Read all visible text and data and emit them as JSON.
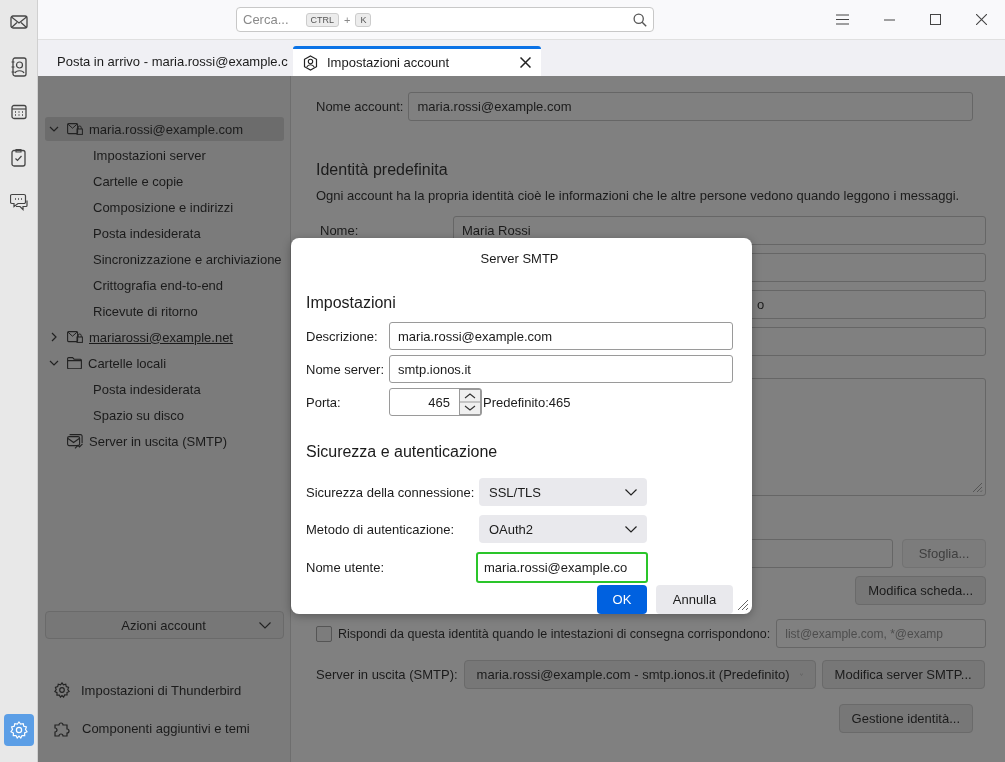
{
  "spaces_bar": {
    "items": [
      {
        "kind": "mail",
        "selected": false
      },
      {
        "kind": "contacts",
        "selected": false
      },
      {
        "kind": "calendar",
        "selected": false
      },
      {
        "kind": "tasks",
        "selected": false
      },
      {
        "kind": "chat",
        "selected": false
      }
    ],
    "bottom": {
      "kind": "settings",
      "selected": true
    }
  },
  "search": {
    "placeholder": "Cerca...",
    "keys": [
      "CTRL",
      "K"
    ],
    "joiner": "+"
  },
  "tabs": [
    {
      "label": "Posta in arrivo - maria.rossi@example.c",
      "kind": "inbox",
      "selected": false,
      "closable": false
    },
    {
      "label": "Impostazioni account",
      "kind": "account",
      "selected": true,
      "closable": true
    }
  ],
  "sidebar": {
    "tree": [
      {
        "label": "maria.rossi@example.com",
        "kind": "account",
        "expanded": true,
        "selected": true,
        "hovered": false,
        "children": [
          {
            "label": "Impostazioni server"
          },
          {
            "label": "Cartelle e copie"
          },
          {
            "label": "Composizione e indirizzi"
          },
          {
            "label": "Posta indesiderata"
          },
          {
            "label": "Sincronizzazione e archiviazione"
          },
          {
            "label": "Crittografia end-to-end"
          },
          {
            "label": "Ricevute di ritorno"
          }
        ]
      },
      {
        "label": "mariarossi@example.net",
        "kind": "account",
        "expanded": false,
        "selected": false,
        "hovered": true
      },
      {
        "label": "Cartelle locali",
        "kind": "folder",
        "expanded": true,
        "selected": false,
        "hovered": false,
        "children": [
          {
            "label": "Posta indesiderata"
          },
          {
            "label": "Spazio su disco"
          }
        ]
      },
      {
        "label": "Server in uscita (SMTP)",
        "kind": "outbox",
        "selected": false,
        "hovered": false
      }
    ],
    "actions_button": "Azioni account",
    "footer": [
      {
        "label": "Impostazioni di Thunderbird",
        "kind": "settings"
      },
      {
        "label": "Componenti aggiuntivi e temi",
        "kind": "addons"
      }
    ]
  },
  "account_form": {
    "account_name": {
      "label": "Nome account:",
      "value": "maria.rossi@example.com"
    },
    "identity_heading": "Identità predefinita",
    "identity_description": "Ogni account ha la propria identità cioè le informazioni che le altre persone vedono quando leggono i messaggi.",
    "name": {
      "label": "Nome:",
      "value": "Maria Rossi"
    },
    "field_3_fragment": "o",
    "browse_button": "Sfoglia...",
    "edit_card_button": "Modifica scheda...",
    "reply_from": {
      "label": "Rispondi da questa identità quando le intestazioni di consegna corrispondono:",
      "checked": false,
      "placeholder": "list@example.com, *@examp"
    },
    "smtp": {
      "label": "Server in uscita (SMTP):",
      "value": "maria.rossi@example.com - smtp.ionos.it (Predefinito)",
      "button": "Modifica server SMTP..."
    },
    "manage_button": "Gestione identità..."
  },
  "dialog": {
    "title": "Server SMTP",
    "settings_heading": "Impostazioni",
    "description": {
      "label": "Descrizione:",
      "value": "maria.rossi@example.com"
    },
    "server": {
      "label": "Nome server:",
      "value": "smtp.ionos.it"
    },
    "port": {
      "label": "Porta:",
      "value": "465",
      "default": "Predefinito:465"
    },
    "security_heading": "Sicurezza e autenticazione",
    "connection_security": {
      "label": "Sicurezza della connessione:",
      "value": "SSL/TLS"
    },
    "auth_method": {
      "label": "Metodo di autenticazione:",
      "value": "OAuth2"
    },
    "username": {
      "label": "Nome utente:",
      "value": "maria.rossi@example.co",
      "focused": true
    },
    "ok_button": "OK",
    "cancel_button": "Annulla"
  }
}
